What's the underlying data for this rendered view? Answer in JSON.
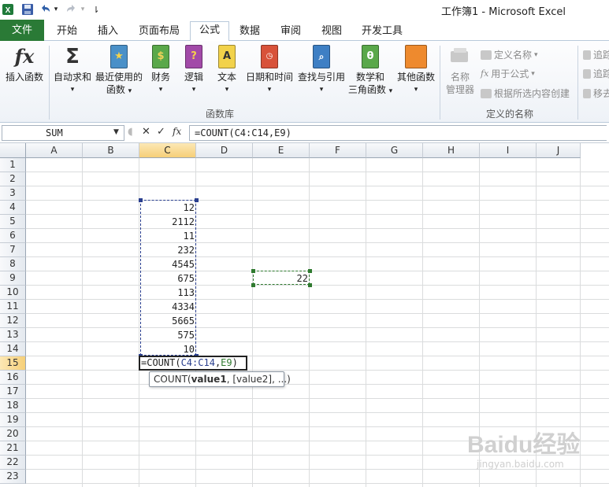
{
  "titlebar": {
    "app_title": "工作簿1 - Microsoft Excel",
    "undo_arrow": "▾",
    "customize": "⇂"
  },
  "tabs": [
    {
      "label": "文件",
      "name": "tab-file"
    },
    {
      "label": "开始",
      "name": "tab-home"
    },
    {
      "label": "插入",
      "name": "tab-insert"
    },
    {
      "label": "页面布局",
      "name": "tab-page-layout"
    },
    {
      "label": "公式",
      "name": "tab-formulas"
    },
    {
      "label": "数据",
      "name": "tab-data"
    },
    {
      "label": "审阅",
      "name": "tab-review"
    },
    {
      "label": "视图",
      "name": "tab-view"
    },
    {
      "label": "开发工具",
      "name": "tab-developer"
    }
  ],
  "ribbon": {
    "insert_function": "插入函数",
    "autosum": "自动求和",
    "recent_line1": "最近使用的",
    "recent_line2": "函数",
    "financial": "财务",
    "logical": "逻辑",
    "text": "文本",
    "datetime": "日期和时间",
    "lookup": "查找与引用",
    "math_line1": "数学和",
    "math_line2": "三角函数",
    "more": "其他函数",
    "library_label": "函数库",
    "name_manager_line1": "名称",
    "name_manager_line2": "管理器",
    "define_name": "定义名称",
    "use_in_formula": "用于公式",
    "create_from_selection": "根据所选内容创建",
    "defined_names_label": "定义的名称",
    "trace_precedents": "追踪",
    "trace_dependents": "追踪",
    "remove_arrows": "移去",
    "dropdown": "▾"
  },
  "formula_bar": {
    "name_box": "SUM",
    "cancel": "✕",
    "enter": "✓",
    "fx": "fx",
    "formula": "=COUNT(C4:C14,E9)"
  },
  "grid": {
    "columns": [
      "A",
      "B",
      "C",
      "D",
      "E",
      "F",
      "G",
      "H",
      "I",
      "J"
    ],
    "rows": [
      "1",
      "2",
      "3",
      "4",
      "5",
      "6",
      "7",
      "8",
      "9",
      "10",
      "11",
      "12",
      "13",
      "14",
      "15",
      "16",
      "17",
      "18",
      "19",
      "20",
      "21",
      "22",
      "23"
    ],
    "c_values": [
      "12",
      "2112",
      "11",
      "232",
      "4545",
      "675",
      "113",
      "4334",
      "5665",
      "575",
      "10"
    ],
    "e9_value": "22",
    "edit_prefix": "=COUNT(",
    "edit_range": "C4:C14",
    "edit_comma": ",",
    "edit_ref": "E9",
    "edit_suffix": ")",
    "tooltip_fn": "COUNT(",
    "tooltip_arg1": "value1",
    "tooltip_rest": ", [value2], ...)",
    "colors": {
      "range_c": "#2a3f8f",
      "range_e": "#2f7a2f",
      "selected_header": "#f6cf78"
    }
  },
  "watermark": {
    "text": "Baidu经验",
    "sub": "jingyan.baidu.com"
  }
}
